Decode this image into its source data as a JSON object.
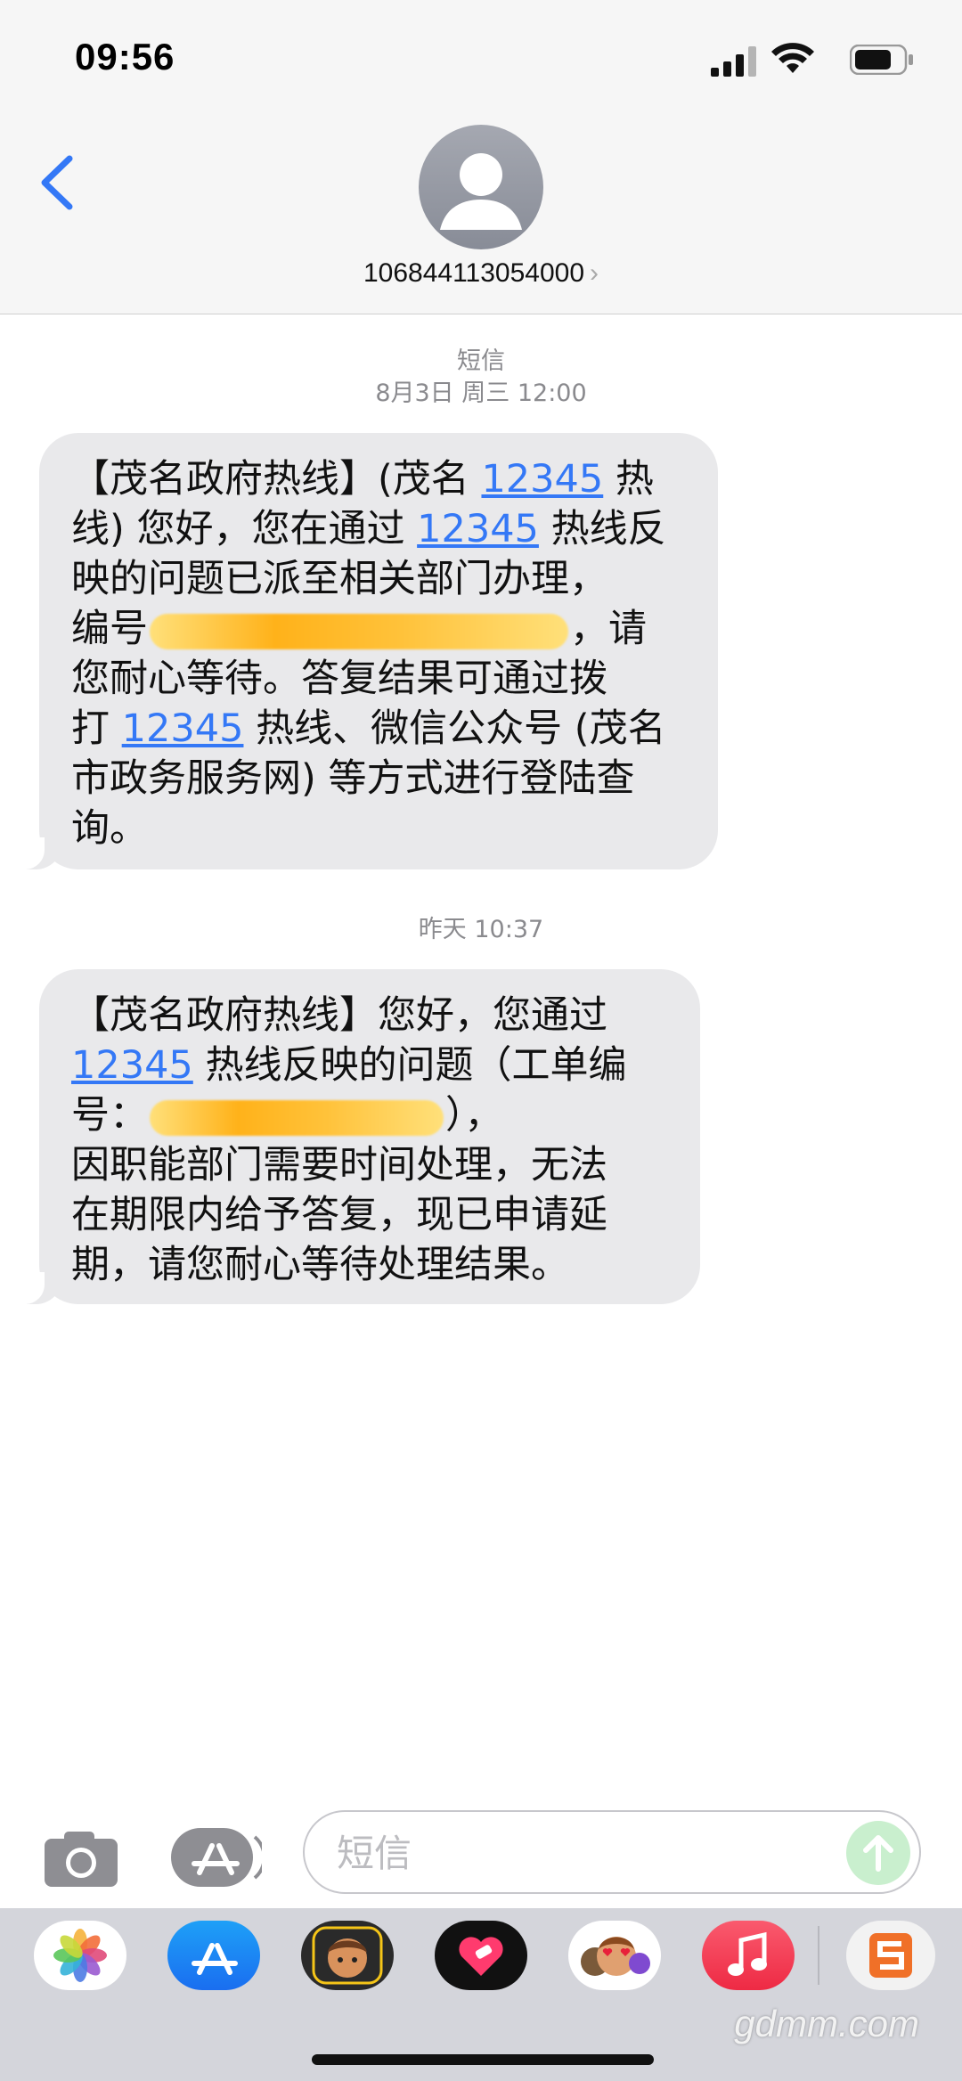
{
  "status_bar": {
    "time": "09:56"
  },
  "header": {
    "contact": "106844113054000",
    "chevron": "›"
  },
  "conversation": {
    "group1": {
      "label": "短信",
      "datetime": "8月3日 周三 12:00"
    },
    "message1": {
      "lines": [
        [
          "【茂名政府热线】(茂名 ",
          {
            "link": "12345"
          },
          " 热"
        ],
        [
          "线) 您好，您在通过 ",
          {
            "link": "12345"
          },
          " 热线反"
        ],
        [
          "映的问题已派至相关部门办理，"
        ],
        [
          "编号",
          {
            "redact": 470
          },
          "，请"
        ],
        [
          "您耐心等待。答复结果可通过拨"
        ],
        [
          "打 ",
          {
            "link": "12345"
          },
          " 热线、微信公众号 (茂名"
        ],
        [
          "市政务服务网) 等方式进行登陆查"
        ],
        [
          "询。"
        ]
      ]
    },
    "group2": {
      "datetime": "昨天 10:37"
    },
    "message2": {
      "lines": [
        [
          "【茂名政府热线】您好，您通过"
        ],
        [
          {
            "link": "12345"
          },
          " 热线反映的问题（工单编"
        ],
        [
          "号：",
          {
            "redact": 330
          },
          "），"
        ],
        [
          "因职能部门需要时间处理，无法"
        ],
        [
          "在期限内给予答复，现已申请延"
        ],
        [
          "期，请您耐心等待处理结果。"
        ]
      ]
    }
  },
  "input": {
    "placeholder": "短信"
  },
  "drawer": {
    "apps": [
      "photos-app",
      "app-store-app",
      "memoji-camera-app",
      "digital-touch-app",
      "memoji-stickers-app",
      "music-app",
      "sogou-keyboard-app"
    ]
  },
  "watermark": "gdmm.com",
  "colors": {
    "link": "#3478f6",
    "bubble": "#e9e9eb",
    "send": "#c9efce"
  }
}
